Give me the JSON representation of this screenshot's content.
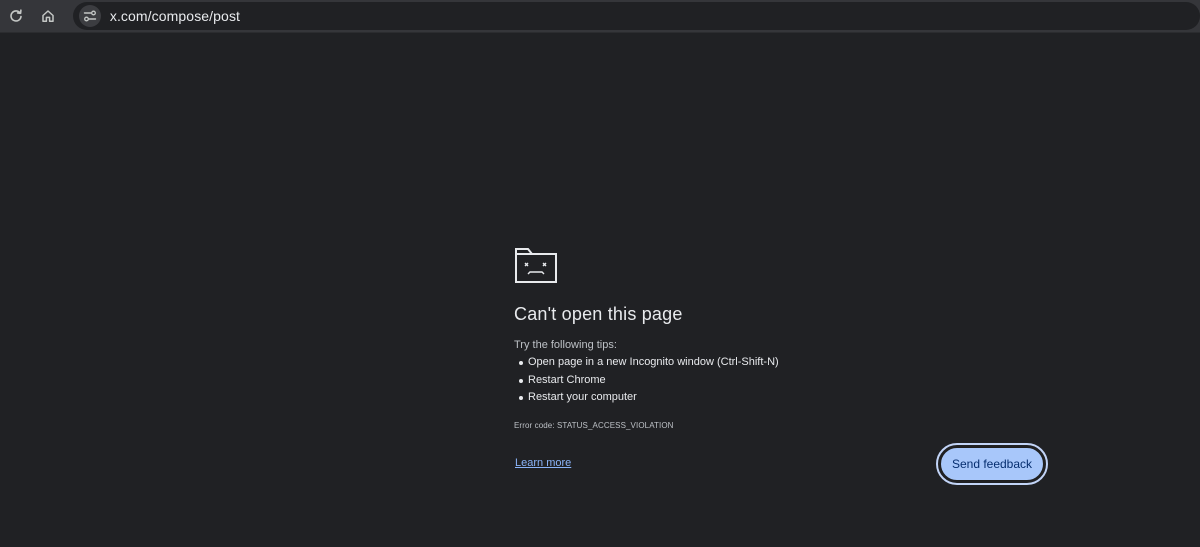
{
  "browser": {
    "url": "x.com/compose/post"
  },
  "error_page": {
    "title": "Can't open this page",
    "tips_heading": "Try the following tips:",
    "tips": [
      "Open page in a new Incognito window (Ctrl-Shift-N)",
      "Restart Chrome",
      "Restart your computer"
    ],
    "error_code": "Error code: STATUS_ACCESS_VIOLATION",
    "learn_more": "Learn more",
    "send_feedback": "Send feedback"
  },
  "icons": {
    "reload": "reload-icon",
    "home": "home-icon",
    "site_info": "site-info-icon",
    "sad_page": "sad-tab-icon"
  },
  "colors": {
    "page_bg": "#202124",
    "toolbar_bg": "#35363a",
    "link": "#8ab4f8",
    "button_fill": "#a8c7fa",
    "button_text": "#062e6f"
  }
}
